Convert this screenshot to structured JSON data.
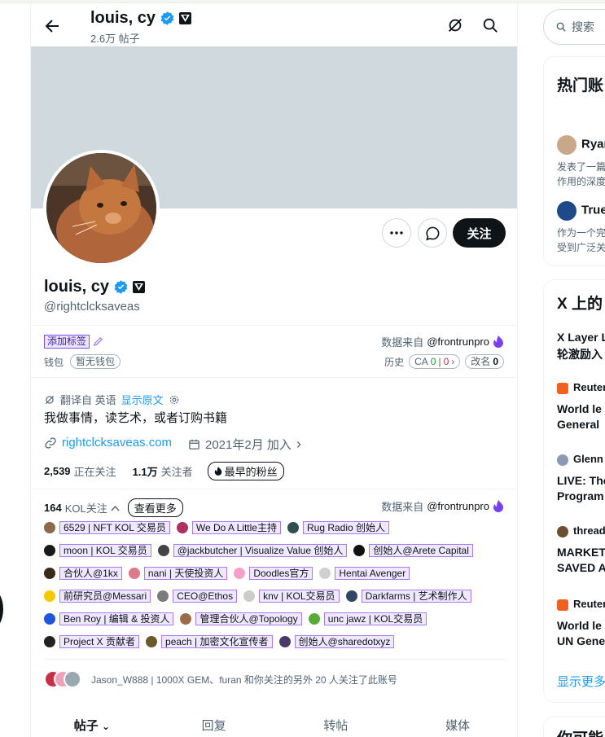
{
  "header": {
    "name": "louis, cy",
    "post_count": "2.6万 帖子"
  },
  "profile": {
    "name": "louis, cy",
    "handle": "@rightclcksaveas",
    "buttons": {
      "follow": "关注"
    }
  },
  "ext_panel": {
    "add_tag": "添加标签",
    "source_label": "数据来自",
    "source_handle": "@frontrunpro",
    "wallet_label": "钱包",
    "wallet_value": "暂无钱包",
    "history_label": "历史",
    "ca_label": "CA",
    "ca_green": "0",
    "ca_red": "0",
    "rename_label": "改名",
    "rename_count": "0"
  },
  "bio": {
    "translate_label": "翻译自 英语",
    "show_original": "显示原文",
    "text": "我做事情，读艺术，或者订购书籍",
    "link": "rightclcksaveas.com",
    "joined": "2021年2月 加入"
  },
  "stats": {
    "following_count": "2,539",
    "following_label": "正在关注",
    "followers_count": "1.1万",
    "followers_label": "关注者",
    "earliest_fans": "最早的粉丝"
  },
  "kol": {
    "count": "164",
    "label": "KOL关注",
    "see_more": "查看更多",
    "source_label": "数据来自",
    "source_handle": "@frontrunpro",
    "rows": [
      [
        {
          "label": "6529 | NFT KOL 交易员",
          "color": "#8a6a4a"
        },
        {
          "label": "We Do A Little主持",
          "color": "#b03060"
        },
        {
          "label": "Rug Radio 创始人",
          "color": "#2f4f4f"
        }
      ],
      [
        {
          "label": "moon | KOL 交易员",
          "color": "#1a1a1a"
        },
        {
          "label": "@jackbutcher | Visualize Value 创始人",
          "color": "#444444"
        },
        {
          "label": "创始人@Arete Capital",
          "color": "#111111"
        }
      ],
      [
        {
          "label": "合伙人@1kx",
          "color": "#3a2a1a"
        },
        {
          "label": "nani | 天使投资人",
          "color": "#e07a8a"
        },
        {
          "label": "Doodles官方",
          "color": "#f5a0c8"
        },
        {
          "label": "Hentai Avenger",
          "color": "#d0d0d0"
        }
      ],
      [
        {
          "label": "前研究员@Messari",
          "color": "#f5c800"
        },
        {
          "label": "CEO@Ethos",
          "color": "#7a7a7a"
        },
        {
          "label": "knv | KOL交易员",
          "color": "#cccccc"
        },
        {
          "label": "Darkfarms | 艺术制作人",
          "color": "#334466"
        }
      ],
      [
        {
          "label": "Ben Roy | 编辑 & 投资人",
          "color": "#2255dd"
        },
        {
          "label": "管理合伙人@Topology",
          "color": "#9a6a4a"
        },
        {
          "label": "unc jawz | KOL交易员",
          "color": "#5aaa3a"
        }
      ],
      [
        {
          "label": "Project X 贡献者",
          "color": "#222222"
        },
        {
          "label": "peach | 加密文化宣传者",
          "color": "#6a5a2a"
        },
        {
          "label": "创始人@sharedotxyz",
          "color": "#4a3a6a"
        }
      ]
    ]
  },
  "mutuals": {
    "text": "Jason_W888 | 1000X GEM、furan 和你关注的另外 20 人关注了此账号"
  },
  "tabs": [
    "帖子",
    "回复",
    "转帖",
    "媒体"
  ],
  "sidebar": {
    "search_placeholder": "搜索",
    "trending_title": "热门账",
    "t1_name": "Ryan",
    "t1_line1": "发表了一篇",
    "t1_line2": "作用的深度",
    "t2_name": "True",
    "t2_line1": "作为一个完",
    "t2_line2": "受到广泛关",
    "news_title": "X 上的",
    "n1_line1": "X Layer L",
    "n1_line2": "轮激励入",
    "n2_src": "Reuter",
    "n2_line1": "World le",
    "n2_line2": "General",
    "n3_src": "Glenn",
    "n3_line1": "LIVE: The",
    "n3_line2": "Program",
    "n4_src": "thread",
    "n4_line1": "MARKET",
    "n4_line2": "SAVED A",
    "n5_src": "Reuter",
    "n5_line1": "World le",
    "n5_line2": "UN Gene",
    "show_more": "显示更多",
    "bottom_title": "你可能"
  }
}
